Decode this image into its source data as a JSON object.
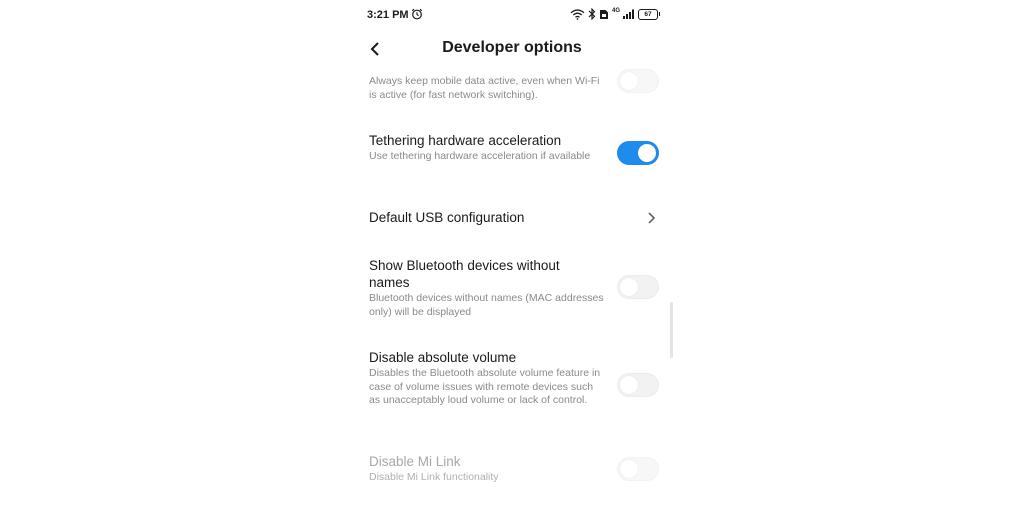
{
  "status_bar": {
    "time": "3:21 PM",
    "battery": "67",
    "network_type": "4G"
  },
  "header": {
    "title": "Developer options"
  },
  "settings": [
    {
      "title": "",
      "subtitle": "Always keep mobile data active, even when Wi-Fi is active (for fast network switching).",
      "control": "toggle",
      "state": "off"
    },
    {
      "title": "Tethering hardware acceleration",
      "subtitle": "Use tethering hardware acceleration if available",
      "control": "toggle",
      "state": "on"
    },
    {
      "title": "Default USB configuration",
      "subtitle": "",
      "control": "chevron"
    },
    {
      "title": "Show Bluetooth devices without names",
      "subtitle": "Bluetooth devices without names (MAC addresses only) will be displayed",
      "control": "toggle",
      "state": "off"
    },
    {
      "title": "Disable absolute volume",
      "subtitle": "Disables the Bluetooth absolute volume feature in case of volume issues with remote devices such as unacceptably loud volume or lack of control.",
      "control": "toggle",
      "state": "off"
    },
    {
      "title": "Disable Mi Link",
      "subtitle": "Disable Mi Link functionality",
      "control": "toggle",
      "state": "off-disabled"
    }
  ],
  "colors": {
    "accent": "#1f8bec",
    "secondary_text": "#8a8a8a",
    "disabled_text": "#a8a8a8"
  }
}
